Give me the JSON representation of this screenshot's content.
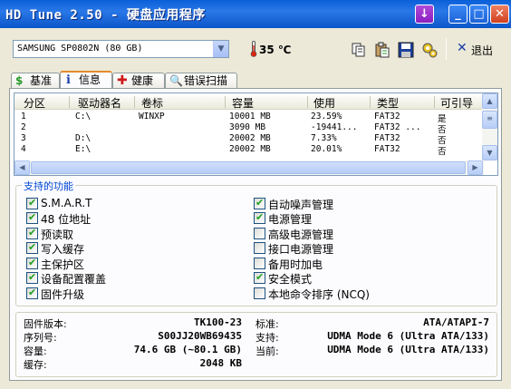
{
  "window": {
    "title": "HD Tune 2.50 - 硬盘应用程序"
  },
  "toolbar": {
    "drive": "SAMSUNG SP0802N (80 GB)",
    "temperature": "35 ℃",
    "exit_label": "退出"
  },
  "tabs": [
    {
      "label": "基准"
    },
    {
      "label": "信息"
    },
    {
      "label": "健康"
    },
    {
      "label": "错误扫描"
    }
  ],
  "partitions": {
    "columns": [
      "分区",
      "驱动器名",
      "卷标",
      "容量",
      "使用",
      "类型",
      "可引导"
    ],
    "rows": [
      [
        "1",
        "C:\\",
        "WINXP",
        "10001 MB",
        "23.59%",
        "FAT32",
        "是"
      ],
      [
        "2",
        "",
        "",
        "3090 MB",
        "-19441...",
        "FAT32 ...",
        "否"
      ],
      [
        "3",
        "D:\\",
        "",
        "20002 MB",
        "7.33%",
        "FAT32",
        "否"
      ],
      [
        "4",
        "E:\\",
        "",
        "20002 MB",
        "20.01%",
        "FAT32",
        "否"
      ]
    ]
  },
  "features": {
    "title": "支持的功能",
    "left": [
      {
        "label": "S.M.A.R.T",
        "checked": true
      },
      {
        "label": "48 位地址",
        "checked": true
      },
      {
        "label": "预读取",
        "checked": true
      },
      {
        "label": "写入缓存",
        "checked": true
      },
      {
        "label": "主保护区",
        "checked": true
      },
      {
        "label": "设备配置覆盖",
        "checked": true
      },
      {
        "label": "固件升级",
        "checked": true
      }
    ],
    "right": [
      {
        "label": "自动噪声管理",
        "checked": true
      },
      {
        "label": "电源管理",
        "checked": true
      },
      {
        "label": "高级电源管理",
        "checked": false
      },
      {
        "label": "接口电源管理",
        "checked": false
      },
      {
        "label": "备用时加电",
        "checked": false
      },
      {
        "label": "安全模式",
        "checked": true
      },
      {
        "label": "本地命令排序 (NCQ)",
        "checked": false
      }
    ]
  },
  "details": {
    "firmware_label": "固件版本:",
    "firmware": "TK100-23",
    "serial_label": "序列号:",
    "serial": "S00JJ20WB69435",
    "capacity_label": "容量:",
    "capacity": "74.6 GB (~80.1 GB)",
    "cache_label": "缓存:",
    "cache": "2048 KB",
    "standard_label": "标准:",
    "standard": "ATA/ATAPI-7",
    "supported_label": "支持:",
    "supported": "UDMA Mode 6 (Ultra ATA/133)",
    "current_label": "当前:",
    "current": "UDMA Mode 6 (Ultra ATA/133)"
  }
}
